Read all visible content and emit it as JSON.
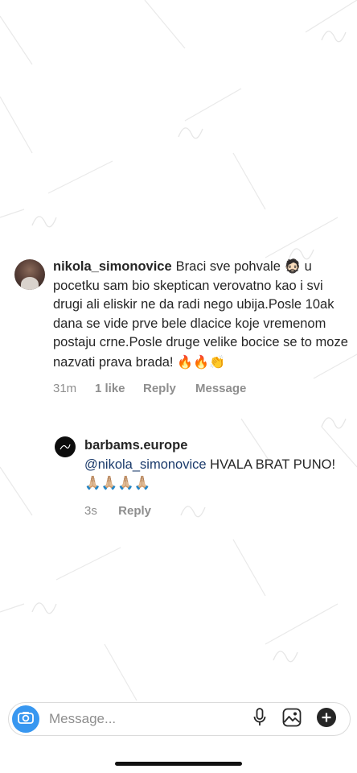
{
  "comment": {
    "username": "nikola_simonovice",
    "text": "Braci sve pohvale 🧔🏻 u pocetku sam bio skeptican verovatno kao i svi drugi ali eliskir ne da radi nego ubija.Posle 10ak dana se vide prve bele dlacice koje vremenom postaju crne.Posle druge velike bocice se to moze nazvati prava brada!",
    "emojis": "🔥🔥👏",
    "time": "31m",
    "likes": "1 like",
    "reply_label": "Reply",
    "message_label": "Message"
  },
  "reply": {
    "username": "barbams.europe",
    "mention": "@nikola_simonovice",
    "text": " HVALA BRAT PUNO! 🙏🏼🙏🏼🙏🏼🙏🏼",
    "time": "3s",
    "reply_label": "Reply"
  },
  "input": {
    "placeholder": "Message..."
  },
  "icons": {
    "camera": "camera-icon",
    "mic": "microphone-icon",
    "gallery": "gallery-icon",
    "plus": "plus-icon"
  },
  "colors": {
    "accent_blue": "#3897f0",
    "mention": "#1a3a6b",
    "muted": "#8e8e8e",
    "text": "#262626"
  }
}
